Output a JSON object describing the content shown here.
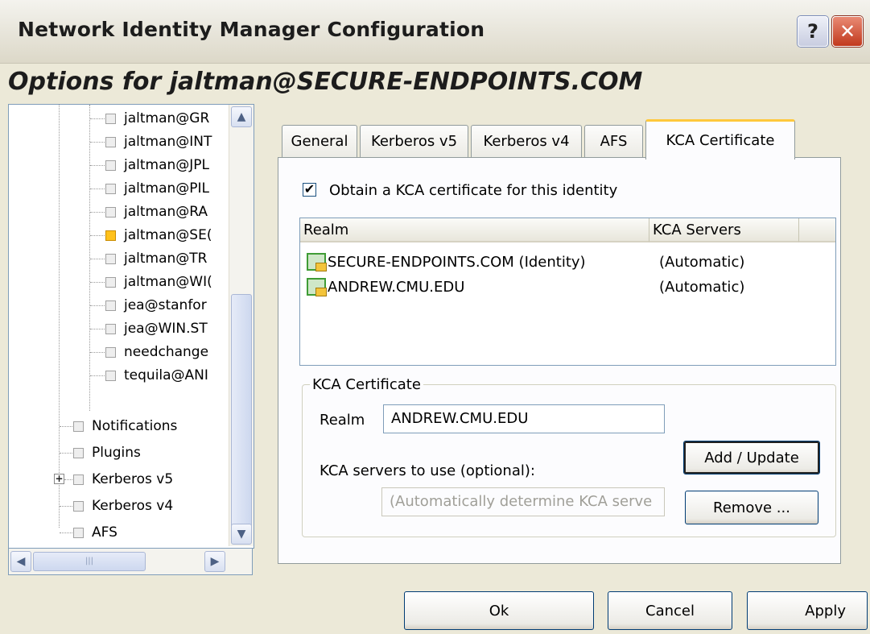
{
  "window": {
    "title": "Network Identity Manager Configuration",
    "help_glyph": "?",
    "close_glyph": "✕"
  },
  "heading": "Options for jaltman@SECURE-ENDPOINTS.COM",
  "tree": {
    "identities": [
      "jaltman@GR",
      "jaltman@INT",
      "jaltman@JPL",
      "jaltman@PIL",
      "jaltman@RA",
      "jaltman@SE(",
      "jaltman@TR",
      "jaltman@WI(",
      "jea@stanfor",
      "jea@WIN.ST",
      "needchange",
      "tequila@ANI"
    ],
    "selected_identity_index": 5,
    "top_items": [
      "Notifications",
      "Plugins",
      "Kerberos v5",
      "Kerberos v4",
      "AFS"
    ],
    "expander_glyph": "+"
  },
  "tabs": [
    "General",
    "Kerberos v5",
    "Kerberos v4",
    "AFS",
    "KCA Certificate"
  ],
  "active_tab": "KCA Certificate",
  "kca": {
    "obtain_checked": true,
    "obtain_label": "Obtain a KCA certificate for this identity",
    "list": {
      "columns": [
        "Realm",
        "KCA Servers"
      ],
      "rows": [
        {
          "realm": "SECURE-ENDPOINTS.COM (Identity)",
          "servers": "(Automatic)"
        },
        {
          "realm": "ANDREW.CMU.EDU",
          "servers": "(Automatic)"
        }
      ]
    },
    "group_title": "KCA Certificate",
    "realm_label": "Realm",
    "realm_value": "ANDREW.CMU.EDU",
    "servers_label": "KCA servers to use (optional):",
    "servers_placeholder": "(Automatically determine KCA serve",
    "add_update_label": "Add / Update",
    "remove_label": "Remove ..."
  },
  "buttons": {
    "ok": "Ok",
    "cancel": "Cancel",
    "apply": "Apply"
  },
  "colors": {
    "selection": "#ffc11b",
    "tab_highlight": "#ffc83c",
    "face": "#ece9d8"
  }
}
